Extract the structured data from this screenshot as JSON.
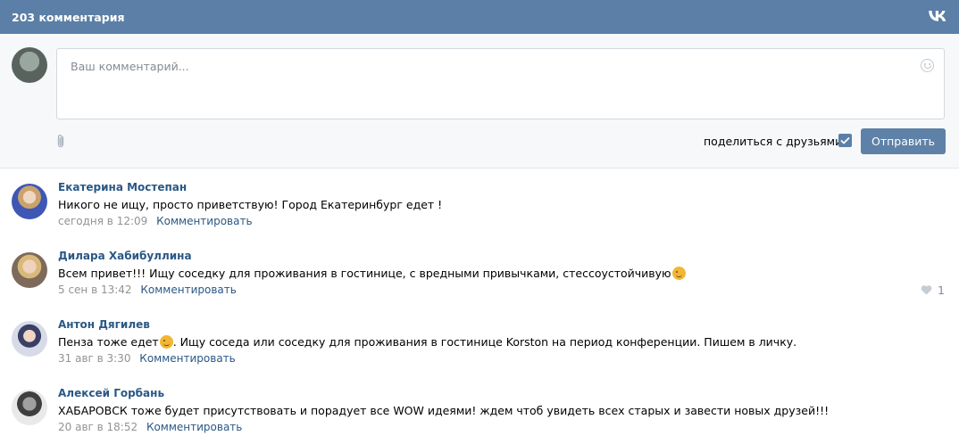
{
  "header": {
    "title": "203 комментария",
    "logo": "vk-logo"
  },
  "composer": {
    "placeholder": "Ваш комментарий...",
    "share_label": "поделиться с друзьями",
    "share_checked": true,
    "send_label": "Отправить"
  },
  "comments": [
    {
      "author": "Екатерина Мостепан",
      "text": "Никого не ищу, просто приветствую! Город Екатеринбург едет !",
      "time": "сегодня в 12:09",
      "reply_label": "Комментировать"
    },
    {
      "author": "Дилара Хабибуллина",
      "text": "Всем привет!!! Ищу соседку для проживания в гостинице, с вредными привычками, стессоустойчивую",
      "time": "5 сен в 13:42",
      "reply_label": "Комментировать",
      "likes": "1"
    },
    {
      "author": "Антон Дягилев",
      "text_before": "Пенза тоже едет",
      "text_after": ". Ищу соседа или соседку для проживания в гостинице Korston на период конференции. Пишем в личку.",
      "time": "31 авг в 3:30",
      "reply_label": "Комментировать"
    },
    {
      "author": "Алексей Горбань",
      "text": "ХАБАРОВСК тоже будет присутствовать и порадует все WOW идеями! ждем чтоб увидеть всех старых и завести новых друзей!!!",
      "time": "20 авг в 18:52",
      "reply_label": "Комментировать"
    }
  ],
  "colors": {
    "header_bg": "#5b7fa6",
    "link": "#2a5885",
    "button_bg": "#5e81a8"
  }
}
